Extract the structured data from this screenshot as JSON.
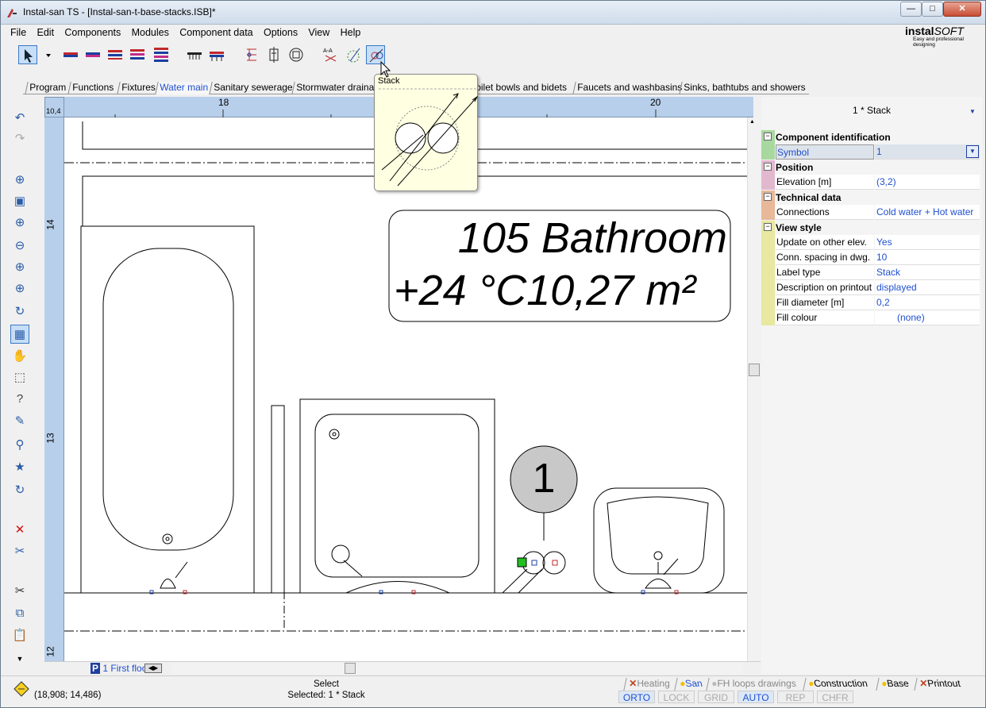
{
  "window": {
    "title": "Instal-san TS - [Instal-san-t-base-stacks.ISB]*"
  },
  "menu": [
    "File",
    "Edit",
    "Components",
    "Modules",
    "Component data",
    "Options",
    "View",
    "Help"
  ],
  "brand": {
    "name_bold": "instal",
    "name_italic": "SOFT",
    "tagline": "Easy and professional designing"
  },
  "tabs": [
    "Program",
    "Functions",
    "Fixtures",
    "Water main",
    "Sanitary sewerage",
    "Stormwater drainage",
    "Toilet bowls and bidets",
    "Faucets and washbasins",
    "Sinks, bathtubs and showers"
  ],
  "active_tab": "Water main",
  "tooltip": {
    "title": "Stack"
  },
  "ruler": {
    "corner": "10,4",
    "h_labels": [
      "18",
      "20"
    ],
    "v_labels": [
      "14",
      "13",
      "12"
    ]
  },
  "drawing": {
    "room_name": "105 Bathroom",
    "room_info": "+24 °C10,27 m²",
    "stack_label": "1"
  },
  "floor_tab": {
    "icon": "P",
    "label": "1 First floor"
  },
  "properties": {
    "header": "1 * Stack",
    "groups": [
      {
        "title": "Component identification",
        "rows": [
          {
            "name": "Symbol",
            "value": "1"
          }
        ]
      },
      {
        "title": "Position",
        "rows": [
          {
            "name": "Elevation [m]",
            "value": "(3,2)"
          }
        ]
      },
      {
        "title": "Technical data",
        "rows": [
          {
            "name": "Connections",
            "value": "Cold water + Hot water"
          }
        ]
      },
      {
        "title": "View style",
        "rows": [
          {
            "name": "Update on other elev.",
            "value": "Yes"
          },
          {
            "name": "Conn. spacing in dwg.",
            "value": "10"
          },
          {
            "name": "Label type",
            "value": "Stack"
          },
          {
            "name": "Description on printout",
            "value": "displayed"
          },
          {
            "name": "Fill diameter [m]",
            "value": "0,2"
          },
          {
            "name": "Fill colour",
            "value": "(none)"
          }
        ]
      }
    ],
    "group_colors": [
      "#a8d8a0",
      "#e2b8cf",
      "#e8b89a",
      "#e8e8a0"
    ]
  },
  "status": {
    "coords": "(18,908; 14,486)",
    "mode": "Select",
    "selected": "Selected: 1 * Stack",
    "module_tabs": [
      {
        "label": "Heating",
        "state": "disabled"
      },
      {
        "label": "San",
        "state": "active"
      },
      {
        "label": "FH loops drawings",
        "state": "disabled"
      },
      {
        "label": "Construction",
        "state": "normal"
      },
      {
        "label": "Base",
        "state": "normal"
      },
      {
        "label": "Printout",
        "state": "normal"
      }
    ],
    "toggles": [
      {
        "label": "ORTO",
        "on": true
      },
      {
        "label": "LOCK",
        "on": false
      },
      {
        "label": "GRID",
        "on": false
      },
      {
        "label": "AUTO",
        "on": true
      },
      {
        "label": "REP",
        "on": false
      },
      {
        "label": "CHFR",
        "on": false
      }
    ]
  }
}
